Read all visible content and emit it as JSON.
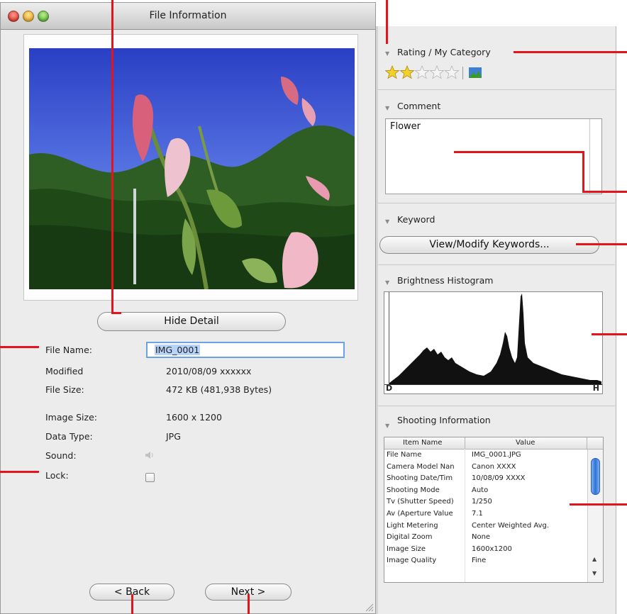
{
  "window": {
    "title": "File Information"
  },
  "detail_button": "Hide Detail",
  "file_info": {
    "file_name_label": "File Name:",
    "file_name_value": "IMG_0001",
    "modified_label": "Modified",
    "modified_value": "2010/08/09 xxxxxx",
    "file_size_label": "File Size:",
    "file_size_value": "472 KB (481,938 Bytes)",
    "image_size_label": "Image Size:",
    "image_size_value": "1600 x 1200",
    "data_type_label": "Data Type:",
    "data_type_value": "JPG",
    "sound_label": "Sound:",
    "lock_label": "Lock:"
  },
  "nav": {
    "back": "< Back",
    "next": "Next >"
  },
  "rating": {
    "title": "Rating / My Category",
    "stars_filled": 2,
    "stars_total": 5
  },
  "comment": {
    "title": "Comment",
    "text": "Flower"
  },
  "keyword": {
    "title": "Keyword",
    "button": "View/Modify Keywords..."
  },
  "histogram": {
    "title": "Brightness Histogram",
    "left_label": "D",
    "right_label": "H"
  },
  "shooting": {
    "title": "Shooting Information",
    "col_item": "Item Name",
    "col_value": "Value",
    "rows": [
      {
        "item": "File Name",
        "value": "IMG_0001.JPG"
      },
      {
        "item": "Camera Model Nan",
        "value": "Canon XXXX"
      },
      {
        "item": "Shooting Date/Tim",
        "value": "10/08/09 XXXX"
      },
      {
        "item": "Shooting Mode",
        "value": "Auto"
      },
      {
        "item": "Tv (Shutter Speed)",
        "value": "1/250"
      },
      {
        "item": "Av (Aperture Value",
        "value": "7.1"
      },
      {
        "item": "Light Metering",
        "value": "Center Weighted Avg."
      },
      {
        "item": "Digital Zoom",
        "value": "None"
      },
      {
        "item": "Image Size",
        "value": "1600x1200"
      },
      {
        "item": "Image Quality",
        "value": "Fine"
      }
    ]
  },
  "icons": {
    "close": "close-icon",
    "minimize": "minimize-icon",
    "zoom": "zoom-icon",
    "star": "star-icon",
    "category": "category-icon",
    "sound": "speaker-icon",
    "lock": "checkbox-icon",
    "disclosure": "disclosure-triangle-icon",
    "resize": "resize-grip-icon"
  },
  "colors": {
    "callout": "#e4141c",
    "selection": "#b7d3f7",
    "focus": "#6aa2e3"
  }
}
